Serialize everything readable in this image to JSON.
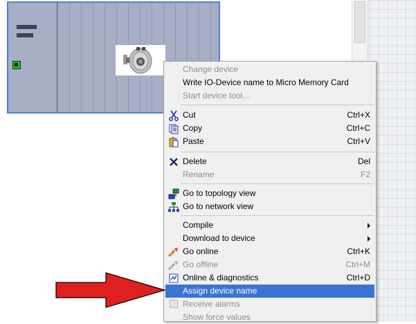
{
  "context_menu": {
    "items": [
      {
        "label": "Change device",
        "shortcut": "",
        "disabled": true
      },
      {
        "label": "Write IO-Device name to Micro Memory Card",
        "shortcut": "",
        "disabled": false
      },
      {
        "label": "Start device tool...",
        "shortcut": "",
        "disabled": true
      },
      {
        "label": "Cut",
        "shortcut": "Ctrl+X",
        "disabled": false
      },
      {
        "label": "Copy",
        "shortcut": "Ctrl+C",
        "disabled": false
      },
      {
        "label": "Paste",
        "shortcut": "Ctrl+V",
        "disabled": false
      },
      {
        "label": "Delete",
        "shortcut": "Del",
        "disabled": false
      },
      {
        "label": "Rename",
        "shortcut": "F2",
        "disabled": true
      },
      {
        "label": "Go to topology view",
        "shortcut": "",
        "disabled": false
      },
      {
        "label": "Go to network view",
        "shortcut": "",
        "disabled": false
      },
      {
        "label": "Compile",
        "shortcut": "",
        "disabled": false
      },
      {
        "label": "Download to device",
        "shortcut": "",
        "disabled": false
      },
      {
        "label": "Go online",
        "shortcut": "Ctrl+K",
        "disabled": false
      },
      {
        "label": "Go offline",
        "shortcut": "Ctrl+M",
        "disabled": true
      },
      {
        "label": "Online & diagnostics",
        "shortcut": "Ctrl+D",
        "disabled": false
      },
      {
        "label": "Assign device name",
        "shortcut": "",
        "disabled": false,
        "highlighted": true
      },
      {
        "label": "Receive alarms",
        "shortcut": "",
        "disabled": true
      },
      {
        "label": "Show force values",
        "shortcut": "",
        "disabled": true
      }
    ]
  },
  "colors": {
    "highlight": "#3a75d4",
    "rack_fill": "#a8aec6",
    "rack_border": "#4f7fd8",
    "port_green": "#19c519",
    "arrow_red": "#e02020"
  },
  "icons": {
    "cut": "scissors-icon",
    "copy": "copy-icon",
    "paste": "paste-icon",
    "delete": "delete-x-icon",
    "topology": "topology-view-icon",
    "network": "network-view-icon",
    "go_online": "go-online-icon",
    "go_offline": "go-offline-icon",
    "diagnostics": "online-diagnostics-icon",
    "pointer": "red-arrow-pointer"
  }
}
